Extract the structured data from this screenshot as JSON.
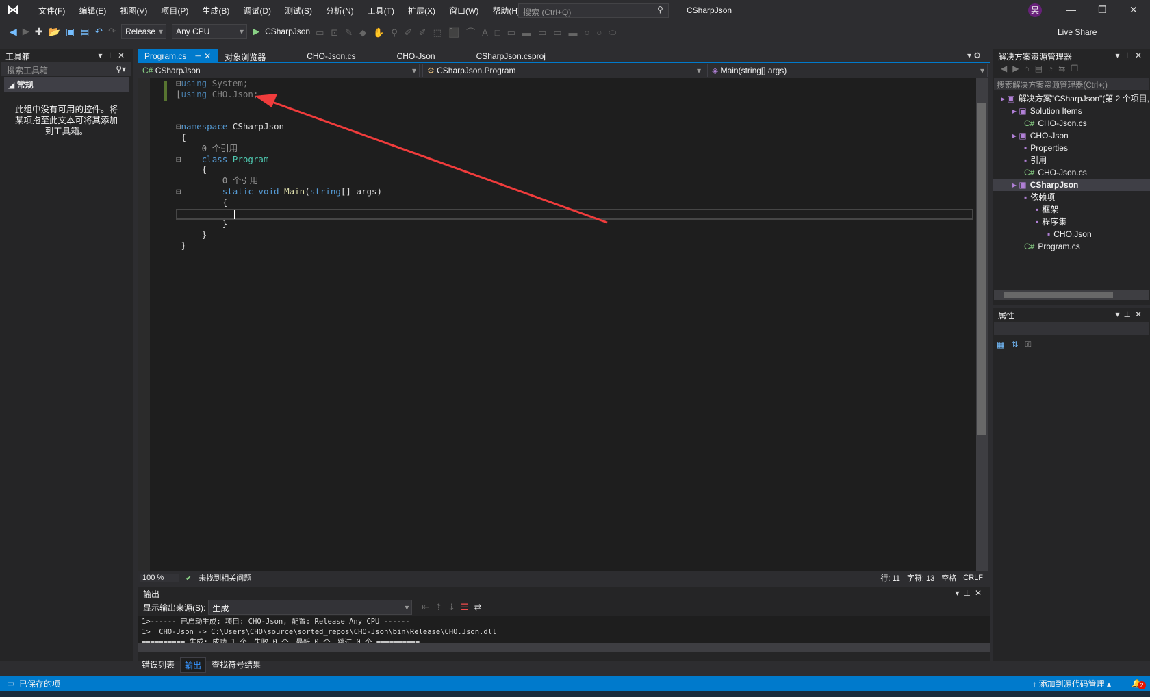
{
  "menubar": {
    "items": [
      "文件(F)",
      "编辑(E)",
      "视图(V)",
      "项目(P)",
      "生成(B)",
      "调试(D)",
      "测试(S)",
      "分析(N)",
      "工具(T)",
      "扩展(X)",
      "窗口(W)",
      "帮助(H)"
    ],
    "search_placeholder": "搜索 (Ctrl+Q)",
    "window_title": "CSharpJson",
    "avatar": "昊"
  },
  "toolbar": {
    "config": "Release",
    "platform": "Any CPU",
    "start": "CSharpJson",
    "live_share": "Live Share"
  },
  "toolbox": {
    "title": "工具箱",
    "search_placeholder": "搜索工具箱",
    "group": "常规",
    "empty_text": "此组中没有可用的控件。将某项拖至此文本可将其添加到工具箱。"
  },
  "tabs": [
    {
      "label": "Program.cs",
      "active": true
    },
    {
      "label": "对象浏览器"
    },
    {
      "label": "CHO-Json.cs"
    },
    {
      "label": "CHO-Json"
    },
    {
      "label": "CSharpJson.csproj"
    }
  ],
  "nav": {
    "project": "CSharpJson",
    "type": "CSharpJson.Program",
    "member": "Main(string[] args)"
  },
  "code": {
    "l1a": "using",
    "l1b": " System;",
    "l2a": "using",
    "l2b": " CHO.Json;",
    "ns_kw": "namespace",
    "ns": " CSharpJson",
    "refs": "0 个引用",
    "class_kw": "class",
    "class_name": " Program",
    "static_void": "static void",
    "main": " Main",
    "arg_type": "string",
    "arg_rest": "[] args)"
  },
  "editor_status": {
    "zoom": "100 %",
    "issues": "未找到相关问题",
    "line": "行: 11",
    "char": "字符: 13",
    "spaces": "空格",
    "eol": "CRLF"
  },
  "output": {
    "title": "输出",
    "source_label": "显示输出来源(S):",
    "source": "生成",
    "lines": [
      "1>------ 已启动生成: 项目: CHO-Json, 配置: Release Any CPU ------",
      "1>  CHO-Json -> C:\\Users\\CHO\\source\\sorted_repos\\CHO-Json\\bin\\Release\\CHO.Json.dll",
      "========== 生成: 成功 1 个，失败 0 个，最新 0 个，跳过 0 个 =========="
    ],
    "tabs": [
      "错误列表",
      "输出",
      "查找符号结果"
    ]
  },
  "solution": {
    "title": "解决方案资源管理器",
    "search_placeholder": "搜索解决方案资源管理器(Ctrl+;)",
    "items": [
      {
        "label": "解决方案\"CSharpJson\"(第 2 个项目,",
        "level": 0
      },
      {
        "label": "Solution Items",
        "level": 1
      },
      {
        "label": "CHO-Json.cs",
        "level": 2
      },
      {
        "label": "CHO-Json",
        "level": 1
      },
      {
        "label": "Properties",
        "level": 2
      },
      {
        "label": "引用",
        "level": 2
      },
      {
        "label": "CHO-Json.cs",
        "level": 2
      },
      {
        "label": "CSharpJson",
        "level": 1,
        "selected": true
      },
      {
        "label": "依赖项",
        "level": 2
      },
      {
        "label": "框架",
        "level": 3
      },
      {
        "label": "程序集",
        "level": 3
      },
      {
        "label": "CHO.Json",
        "level": 4
      },
      {
        "label": "Program.cs",
        "level": 2
      }
    ]
  },
  "properties": {
    "title": "属性"
  },
  "statusbar": {
    "saved": "已保存的项",
    "source_control": "添加到源代码管理",
    "notifications": "2"
  },
  "colors": {
    "accent": "#007acc",
    "arrow": "#f03c3c"
  }
}
